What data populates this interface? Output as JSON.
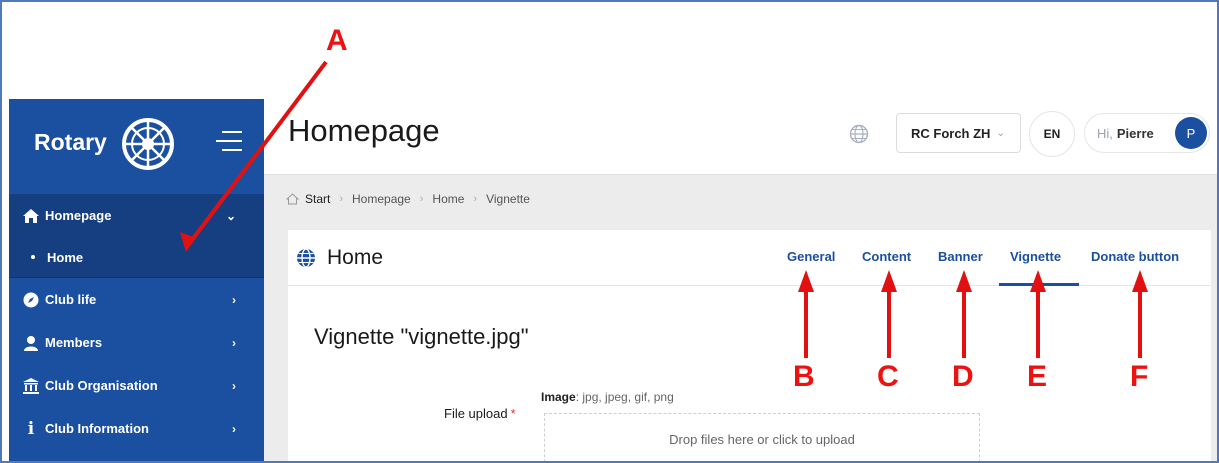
{
  "sidebar": {
    "logo_text": "Rotary",
    "items": [
      {
        "label": "Homepage",
        "icon": "home-icon"
      },
      {
        "label": "Home",
        "sub": true
      },
      {
        "label": "Club life",
        "icon": "compass-icon"
      },
      {
        "label": "Members",
        "icon": "user-icon"
      },
      {
        "label": "Club Organisation",
        "icon": "building-icon"
      },
      {
        "label": "Club Information",
        "icon": "info-icon"
      }
    ]
  },
  "header": {
    "title": "Homepage",
    "club": "RC Forch ZH",
    "language": "EN",
    "greeting": "Hi,",
    "user_name": "Pierre",
    "avatar_initial": "P"
  },
  "breadcrumb": [
    "Start",
    "Homepage",
    "Home",
    "Vignette"
  ],
  "panel": {
    "title": "Home",
    "tabs": [
      "General",
      "Content",
      "Banner",
      "Vignette",
      "Donate button"
    ],
    "active_tab": "Vignette",
    "section_title": "Vignette \"vignette.jpg\"",
    "file_label": "File upload",
    "required_mark": "*",
    "image_label": "Image",
    "image_formats": ": jpg, jpeg, gif, png",
    "dropzone_text": "Drop files here or click to upload"
  },
  "annotations": [
    "A",
    "B",
    "C",
    "D",
    "E",
    "F"
  ],
  "colors": {
    "brand_blue": "#1b4fa0",
    "annotation_red": "#e11111"
  }
}
